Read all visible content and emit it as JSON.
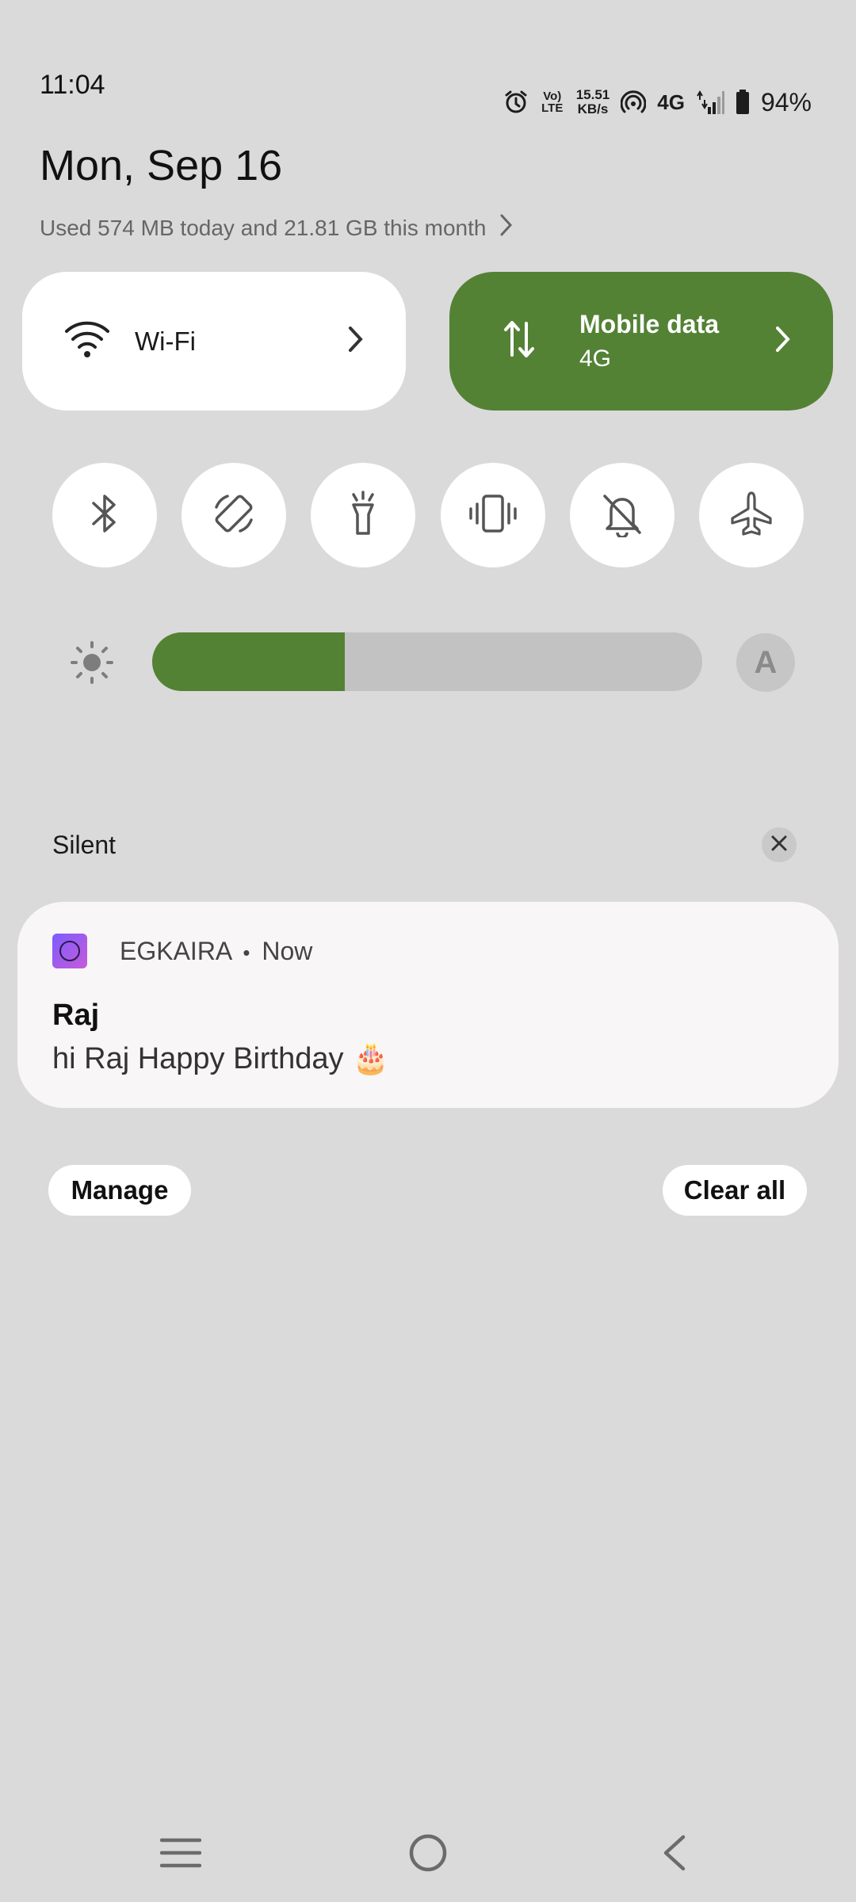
{
  "status_bar": {
    "time": "11:04",
    "volte_top": "Vo)",
    "volte_bottom": "LTE",
    "speed_value": "15.51",
    "speed_unit": "KB/s",
    "network_type": "4G",
    "battery_percent": "94%"
  },
  "header": {
    "date": "Mon, Sep 16",
    "data_usage": "Used 574 MB today and 21.81 GB this month"
  },
  "tiles": {
    "wifi_label": "Wi-Fi",
    "mobile_label": "Mobile data",
    "mobile_sub": "4G"
  },
  "quick_toggles": [
    {
      "icon": "bluetooth-icon"
    },
    {
      "icon": "auto-rotate-icon"
    },
    {
      "icon": "flashlight-icon"
    },
    {
      "icon": "vibrate-icon"
    },
    {
      "icon": "do-not-disturb-icon"
    },
    {
      "icon": "airplane-mode-icon"
    }
  ],
  "brightness": {
    "level_fraction": 0.35,
    "auto_label": "A"
  },
  "notifications_section": {
    "label": "Silent"
  },
  "notification": {
    "app_name": "EGKAIRA",
    "separator": "•",
    "time": "Now",
    "title": "Raj",
    "body": "hi Raj Happy Birthday 🎂"
  },
  "actions": {
    "manage_label": "Manage",
    "clear_all_label": "Clear all"
  },
  "colors": {
    "accent": "#548235",
    "background": "#dadada",
    "tile": "#ffffff"
  }
}
